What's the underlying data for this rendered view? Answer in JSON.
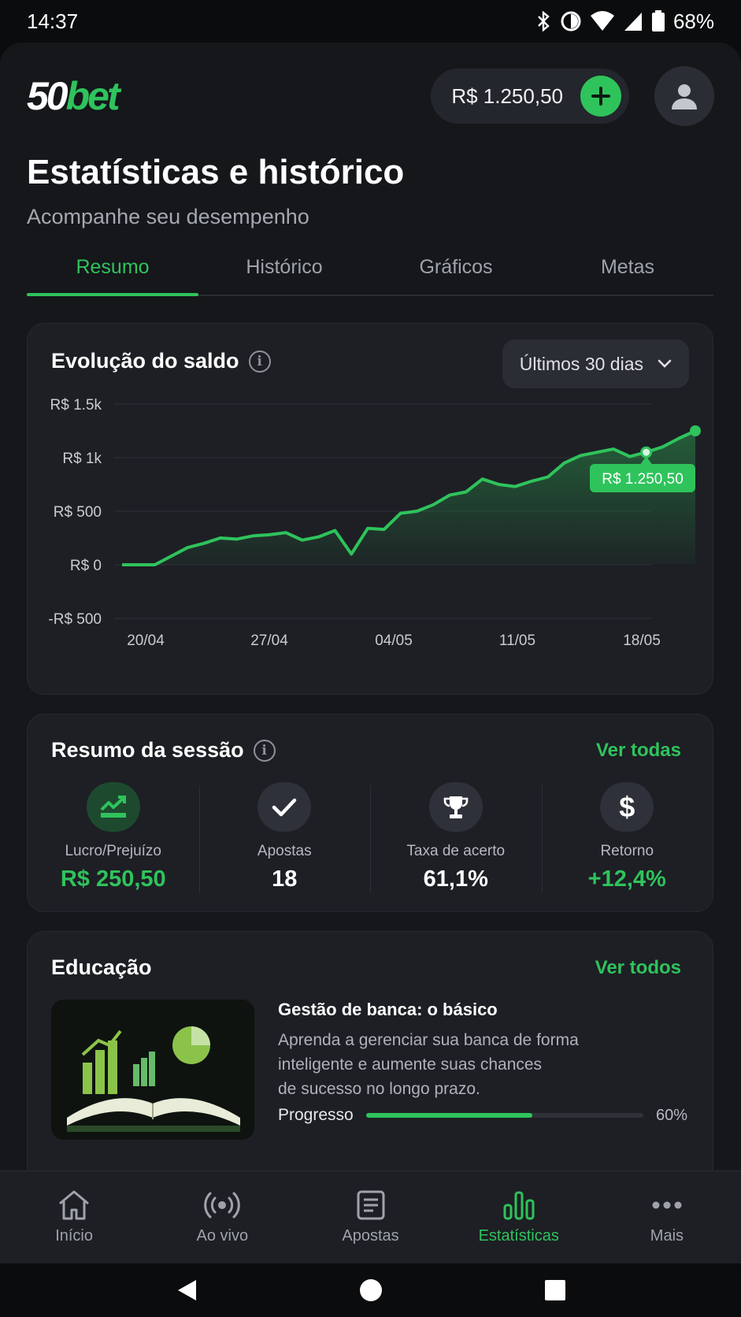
{
  "status_bar": {
    "time": "14:37",
    "battery": "68%"
  },
  "header": {
    "logo_num": "50",
    "logo_word": "bet",
    "balance": "R$ 1.250,50"
  },
  "page": {
    "title": "Estatísticas e histórico",
    "subtitle": "Acompanhe seu desempenho"
  },
  "tabs": [
    {
      "label": "Resumo",
      "active": true
    },
    {
      "label": "Histórico",
      "active": false
    },
    {
      "label": "Gráficos",
      "active": false
    },
    {
      "label": "Metas",
      "active": false
    }
  ],
  "balance_card": {
    "title": "Evolução do saldo",
    "range": "Últimos 30 dias"
  },
  "chart_data": {
    "type": "area",
    "title": "Evolução do saldo",
    "y_ticks": [
      "R$ 1.5k",
      "R$ 1k",
      "R$ 500",
      "R$ 0",
      "-R$ 500"
    ],
    "y_tick_values": [
      1500,
      1000,
      500,
      0,
      -500
    ],
    "x_ticks": [
      "20/04",
      "27/04",
      "04/05",
      "11/05",
      "18/05"
    ],
    "ylim": [
      -500,
      1500
    ],
    "grid": true,
    "color": "#2fc35c",
    "callout": "R$ 1.250,50",
    "series": [
      {
        "values": [
          0,
          0,
          0,
          80,
          160,
          200,
          250,
          240,
          270,
          280,
          300,
          230,
          260,
          320,
          100,
          340,
          330,
          480,
          500,
          560,
          650,
          680,
          800,
          750,
          730,
          780,
          820,
          950,
          1020,
          1050,
          1080,
          1010,
          1050,
          1100,
          1180,
          1250
        ]
      }
    ]
  },
  "session": {
    "title": "Resumo da sessão",
    "see_all": "Ver todas",
    "stats": [
      {
        "label": "Lucro/Prejuízo",
        "value": "R$ 250,50",
        "icon": "trend-up-icon"
      },
      {
        "label": "Apostas",
        "value": "18",
        "icon": "check-icon"
      },
      {
        "label": "Taxa de acerto",
        "value": "61,1%",
        "icon": "trophy-icon"
      },
      {
        "label": "Retorno",
        "value": "+12,4%",
        "icon": "dollar-icon"
      }
    ]
  },
  "education": {
    "title": "Educação",
    "see_all": "Ver todos",
    "course_title": "Gestão de banca: o básico",
    "course_desc": "Aprenda a gerenciar sua banca de forma\ninteligente e aumente suas chances\nde sucesso no longo prazo.",
    "progress_label": "Progresso",
    "progress_pct": "60%",
    "progress_value": 0.6
  },
  "bottom_nav": [
    {
      "label": "Início",
      "icon": "home-icon",
      "active": false
    },
    {
      "label": "Ao vivo",
      "icon": "live-icon",
      "active": false
    },
    {
      "label": "Apostas",
      "icon": "bets-icon",
      "active": false
    },
    {
      "label": "Estatísticas",
      "icon": "stats-icon",
      "active": true
    },
    {
      "label": "Mais",
      "icon": "more-icon",
      "active": false
    }
  ]
}
